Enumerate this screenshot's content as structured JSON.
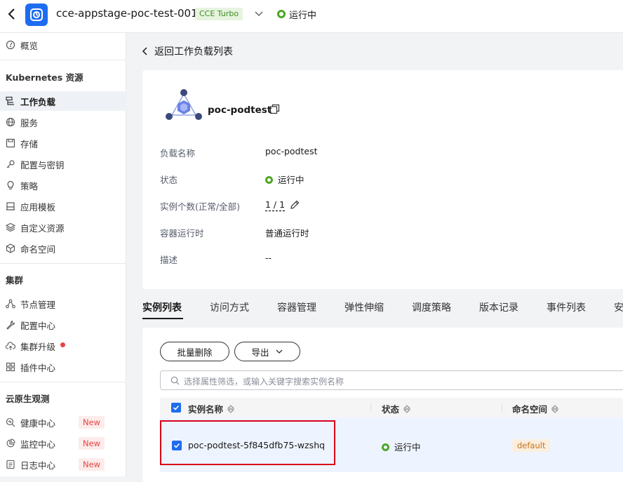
{
  "header": {
    "cluster_name": "cce-appstage-poc-test-001",
    "cluster_tag": "CCE Turbo",
    "status": "运行中"
  },
  "sidebar": {
    "overview": "概览",
    "group_k8s": "Kubernetes 资源",
    "k8s_items": [
      {
        "label": "工作负载",
        "icon": "workload-icon"
      },
      {
        "label": "服务",
        "icon": "globe-icon"
      },
      {
        "label": "存储",
        "icon": "storage-icon"
      },
      {
        "label": "配置与密钥",
        "icon": "key-icon"
      },
      {
        "label": "策略",
        "icon": "bulb-icon"
      },
      {
        "label": "应用模板",
        "icon": "template-icon"
      },
      {
        "label": "自定义资源",
        "icon": "layers-icon"
      },
      {
        "label": "命名空间",
        "icon": "cube-icon"
      }
    ],
    "group_cluster": "集群",
    "cluster_items": [
      {
        "label": "节点管理",
        "icon": "nodes-icon"
      },
      {
        "label": "配置中心",
        "icon": "wrench-icon"
      },
      {
        "label": "集群升级",
        "icon": "cloud-upgrade-icon"
      },
      {
        "label": "插件中心",
        "icon": "plugin-grid-icon"
      }
    ],
    "group_observe": "云原生观测",
    "observe_items": [
      {
        "label": "健康中心",
        "icon": "health-search-icon",
        "badge": "New"
      },
      {
        "label": "监控中心",
        "icon": "pie-chart-icon",
        "badge": "New"
      },
      {
        "label": "日志中心",
        "icon": "log-file-icon",
        "badge": "New"
      }
    ]
  },
  "main": {
    "back_label": "返回工作负载列表",
    "workload_name": "poc-podtest",
    "details": [
      {
        "label": "负载名称",
        "value": "poc-podtest"
      },
      {
        "label": "状态",
        "value": "运行中"
      },
      {
        "label": "实例个数(正常/全部)",
        "value": "1 / 1"
      },
      {
        "label": "容器运行时",
        "value": "普通运行时"
      },
      {
        "label": "描述",
        "value": "--"
      }
    ],
    "tabs": [
      "实例列表",
      "访问方式",
      "容器管理",
      "弹性伸缩",
      "调度策略",
      "版本记录",
      "事件列表",
      "安"
    ],
    "batch_delete": "批量删除",
    "export": "导出",
    "search_placeholder": "选择属性筛选，或输入关键字搜索实例名称",
    "columns": [
      "实例名称",
      "状态",
      "命名空间"
    ],
    "rows": [
      {
        "name": "poc-podtest-5f845dfb75-wzshq",
        "status": "运行中",
        "namespace": "default"
      }
    ]
  },
  "colors": {
    "accent": "#1e6cf0",
    "running": "#4fa628",
    "new_badge": "#e54545",
    "highlight": "#d9001b"
  }
}
